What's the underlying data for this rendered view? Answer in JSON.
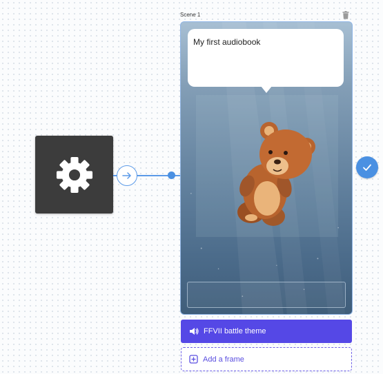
{
  "settings_node": {
    "icon": "gear-icon",
    "color": "#3c3c3c"
  },
  "connector": {
    "icon": "arrow-right-circle-icon",
    "color": "#5b9ae8"
  },
  "scene": {
    "label": "Scene 1",
    "delete_icon": "trash-icon",
    "bubble_text": "My first audiobook",
    "image": "teddy-bear-illustration",
    "text_box_value": "",
    "confirm_icon": "check-icon"
  },
  "audio": {
    "icon": "speaker-icon",
    "label": "FFVII battle theme",
    "color": "#5548e6"
  },
  "add_frame": {
    "icon": "add-frame-icon",
    "label": "Add a frame"
  }
}
